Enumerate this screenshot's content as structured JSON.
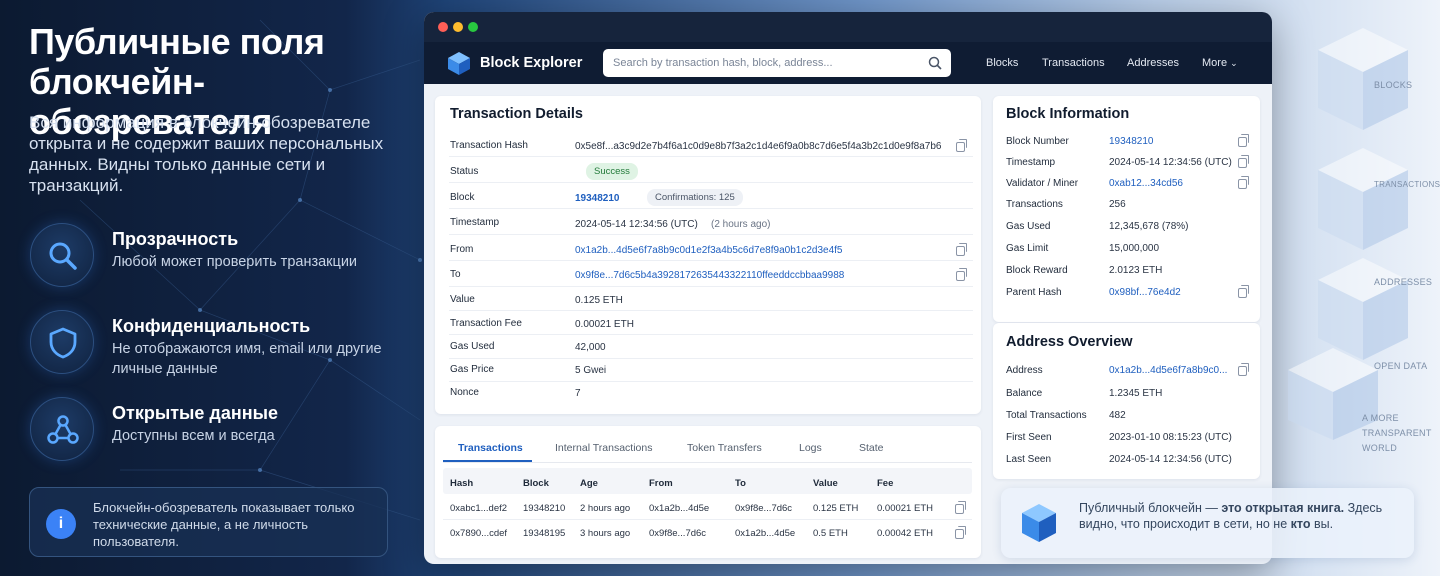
{
  "left": {
    "title_line1": "Публичные поля",
    "title_line2": "блокчейн-обозревателя",
    "lead": "Вся информация в блокчейн-обозревателе открыта и не содержит ваших персональных данных. Видны только данные сети и транзакций.",
    "features": [
      {
        "icon": "magnifier-icon",
        "title": "Прозрачность",
        "desc": "Любой может проверить транзакции"
      },
      {
        "icon": "shield-icon",
        "title": "Конфиденциальность",
        "desc": "Не отображаются имя, email или другие личные данные"
      },
      {
        "icon": "network-nodes-icon",
        "title": "Открытые данные",
        "desc": "Доступны всем и всегда"
      }
    ],
    "note_icon": "i",
    "note": "Блокчейн-обозреватель показывает только технические данные, а не личность пользователя."
  },
  "browser": {
    "brand": "Block Explorer",
    "search_placeholder": "Search by transaction hash, block, address...",
    "nav": [
      "Blocks",
      "Transactions",
      "Addresses",
      "More"
    ],
    "tx": {
      "title": "Transaction Details",
      "rows": [
        {
          "label": "Transaction Hash",
          "value": "0x5e8f...a3c9d2e7b4f6a1c0d9e8b7f3a2c1d4e6f9a0b8c7d6e5f4a3b2c1d0e9f8a7b6"
        },
        {
          "label": "Status",
          "value": "Success"
        },
        {
          "label": "Block",
          "value": "19348210",
          "extra": "Confirmations: 125"
        },
        {
          "label": "Timestamp",
          "value": "2024-05-14 12:34:56 (UTC)",
          "extra": "(2 hours ago)"
        },
        {
          "label": "From",
          "value": "0x1a2b...4d5e6f7a8b9c0d1e2f3a4b5c6d7e8f9a0b1c2d3e4f5"
        },
        {
          "label": "To",
          "value": "0x9f8e...7d6c5b4a3928172635443322110ffeeddccbbaa9988"
        },
        {
          "label": "Value",
          "value": "0.125 ETH"
        },
        {
          "label": "Transaction Fee",
          "value": "0.00021 ETH"
        },
        {
          "label": "Gas Used",
          "value": "42,000"
        },
        {
          "label": "Gas Price",
          "value": "5 Gwei"
        },
        {
          "label": "Nonce",
          "value": "7"
        }
      ]
    },
    "tabs": [
      "Transactions",
      "Internal Transactions",
      "Token Transfers",
      "Logs",
      "State"
    ],
    "table": {
      "headers": [
        "Hash",
        "Block",
        "Age",
        "From",
        "To",
        "Value",
        "Fee"
      ],
      "rows": [
        [
          "0xabc1...def2",
          "19348210",
          "2 hours ago",
          "0x1a2b...4d5e",
          "0x9f8e...7d6c",
          "0.125 ETH",
          "0.00021 ETH"
        ],
        [
          "0x7890...cdef",
          "19348195",
          "3 hours ago",
          "0x9f8e...7d6c",
          "0x1a2b...4d5e",
          "0.5 ETH",
          "0.00042 ETH"
        ]
      ]
    },
    "block": {
      "title": "Block Information",
      "rows": [
        {
          "label": "Block Number",
          "value": "19348210"
        },
        {
          "label": "Timestamp",
          "value": "2024-05-14 12:34:56 (UTC)"
        },
        {
          "label": "Validator / Miner",
          "value": "0xab12...34cd56"
        },
        {
          "label": "Transactions",
          "value": "256"
        },
        {
          "label": "Gas Used",
          "value": "12,345,678 (78%)"
        },
        {
          "label": "Gas Limit",
          "value": "15,000,000"
        },
        {
          "label": "Block Reward",
          "value": "2.0123 ETH"
        },
        {
          "label": "Parent Hash",
          "value": "0x98bf...76e4d2"
        }
      ]
    },
    "address": {
      "title": "Address Overview",
      "rows": [
        {
          "label": "Address",
          "value": "0x1a2b...4d5e6f7a8b9c0..."
        },
        {
          "label": "Balance",
          "value": "1.2345 ETH"
        },
        {
          "label": "Total Transactions",
          "value": "482"
        },
        {
          "label": "First Seen",
          "value": "2023-01-10 08:15:23 (UTC)"
        },
        {
          "label": "Last Seen",
          "value": "2024-05-14 12:34:56 (UTC)"
        }
      ]
    }
  },
  "banner": {
    "p1": "Публичный блокчейн — ",
    "b1": "это открытая книга.",
    "p2": " Здесь видно, что происходит в сети, но не ",
    "b2": "кто",
    "p3": " вы."
  },
  "right_labels": [
    "BLOCKS",
    "TRANSACTIONS",
    "ADDRESSES",
    "OPEN DATA",
    "A MORE",
    "TRANSPARENT",
    "WORLD"
  ],
  "colors": {
    "accent": "#1f5fbf",
    "success_bg": "#dff3e4",
    "success_text": "#237a3a",
    "nav_bg": "#0f1c33"
  }
}
